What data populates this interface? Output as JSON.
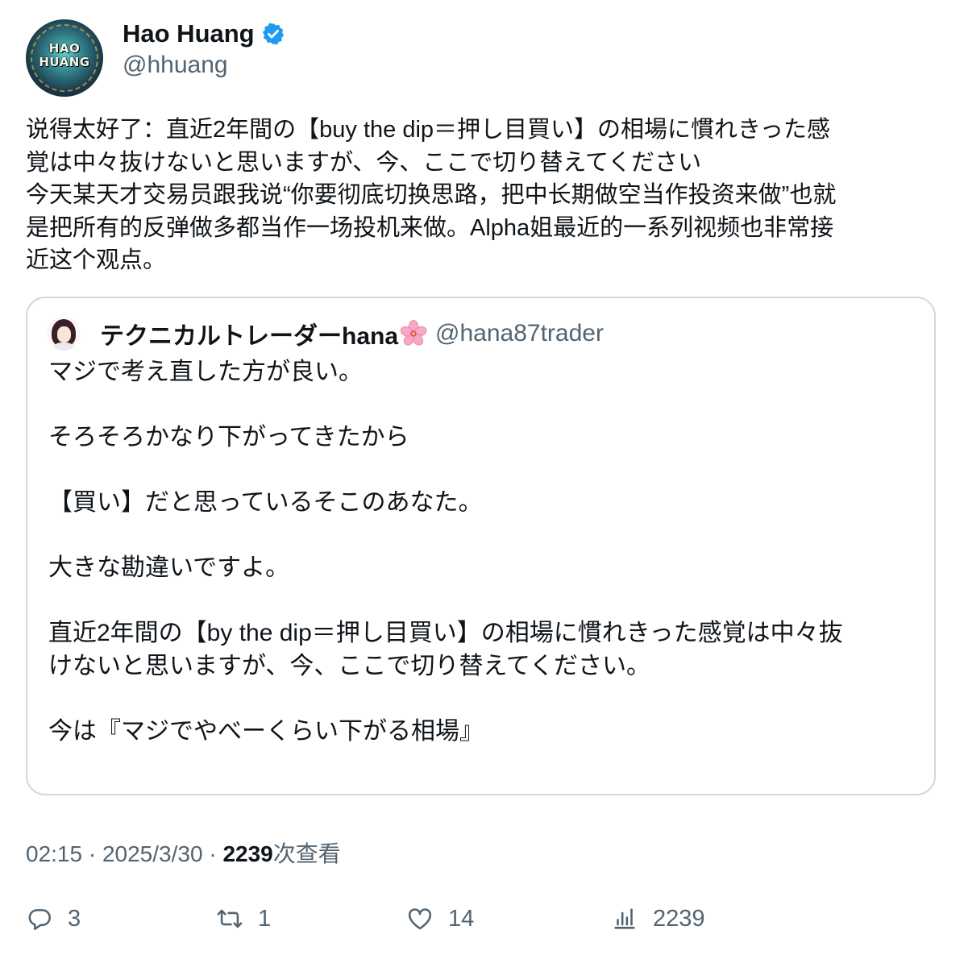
{
  "author": {
    "display_name": "Hao Huang",
    "handle": "@hhuang",
    "avatar_text_line1": "HAO",
    "avatar_text_line2": "HUANG",
    "verified_icon": "verified-badge-icon",
    "verified_color": "#1d9bf0"
  },
  "tweet": {
    "lines": [
      "说得太好了：直近2年間の【buy the dip＝押し目買い】の相場に慣れきった感",
      "覚は中々抜けないと思いますが、今、ここで切り替えてください",
      "今天某天才交易员跟我说“你要彻底切换思路，把中长期做空当作投资来做”也就",
      "是把所有的反弹做多都当作一场投机来做。Alpha姐最近的一系列视频也非常接",
      "近这个观点。"
    ]
  },
  "quote": {
    "display_name": "テクニカルトレーダーhana",
    "name_emoji": "cherry-blossom-icon",
    "handle": "@hana87trader",
    "lines": [
      "マジで考え直した方が良い。",
      "",
      "そろそろかなり下がってきたから",
      "",
      "【買い】だと思っているそこのあなた。",
      "",
      "大きな勘違いですよ。",
      "",
      "直近2年間の【by the dip＝押し目買い】の相場に慣れきった感覚は中々抜",
      "けないと思いますが、今、ここで切り替えてください。",
      "",
      "今は『マジでやべーくらい下がる相場』"
    ]
  },
  "meta": {
    "time": "02:15",
    "separator": " · ",
    "date": "2025/3/30",
    "views_count": "2239",
    "views_label": "次查看"
  },
  "actions": {
    "reply": {
      "icon": "reply-icon",
      "count": "3"
    },
    "retweet": {
      "icon": "retweet-icon",
      "count": "1"
    },
    "like": {
      "icon": "heart-icon",
      "count": "14"
    },
    "views": {
      "icon": "analytics-icon",
      "count": "2239"
    }
  },
  "colors": {
    "text_primary": "#0f1419",
    "text_secondary": "#536471",
    "border": "#cfd9de"
  }
}
